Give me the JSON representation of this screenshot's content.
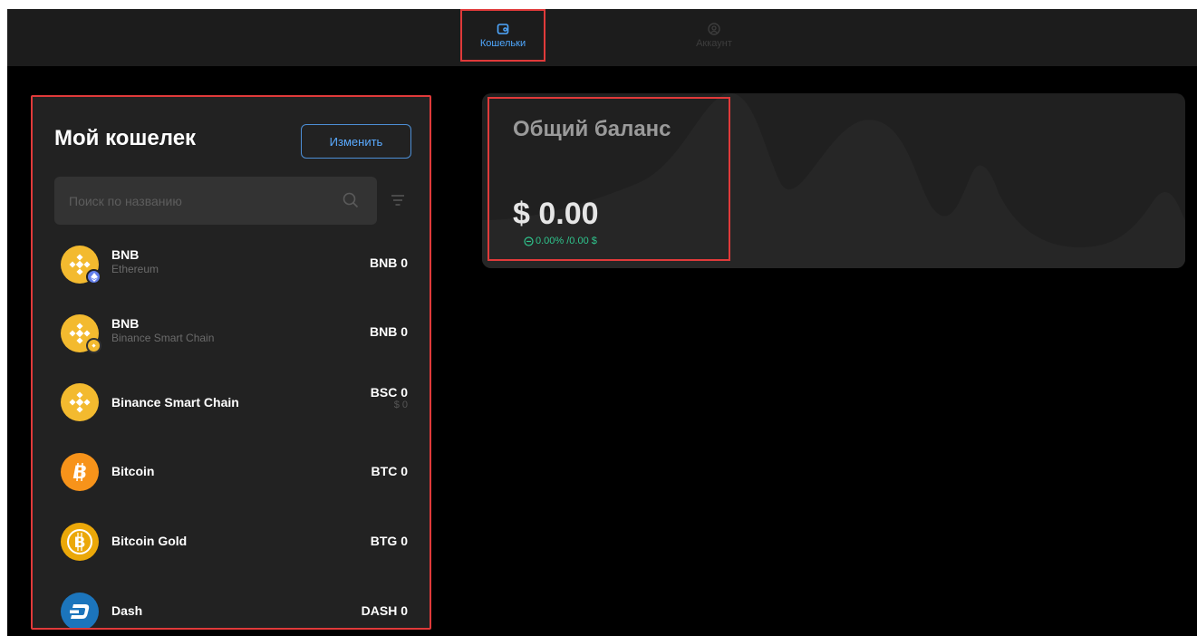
{
  "nav": {
    "wallets_label": "Кошельки",
    "account_label": "Аккаунт",
    "active": "wallets",
    "active_color": "#4fa8ff"
  },
  "wallet": {
    "title": "Мой кошелек",
    "edit_label": "Изменить",
    "search_placeholder": "Поиск по названию",
    "items": [
      {
        "name": "BNB",
        "subtitle": "Ethereum",
        "amount": "BNB 0",
        "fiat": "",
        "icon": "binance-icon",
        "badge": "ethereum-badge-icon"
      },
      {
        "name": "BNB",
        "subtitle": "Binance Smart Chain",
        "amount": "BNB 0",
        "fiat": "",
        "icon": "binance-icon",
        "badge": "bsc-badge-icon"
      },
      {
        "name": "Binance Smart Chain",
        "subtitle": "",
        "amount": "BSC 0",
        "fiat": "$ 0",
        "icon": "binance-icon",
        "badge": ""
      },
      {
        "name": "Bitcoin",
        "subtitle": "",
        "amount": "BTC 0",
        "fiat": "",
        "icon": "bitcoin-icon",
        "badge": ""
      },
      {
        "name": "Bitcoin Gold",
        "subtitle": "",
        "amount": "BTG 0",
        "fiat": "",
        "icon": "bitcoin-gold-icon",
        "badge": ""
      },
      {
        "name": "Dash",
        "subtitle": "",
        "amount": "DASH 0",
        "fiat": "",
        "icon": "dash-icon",
        "badge": ""
      }
    ]
  },
  "balance": {
    "title": "Общий баланс",
    "amount": "$ 0.00",
    "change": "0.00% /0.00 $",
    "change_color": "#2fc58d"
  },
  "colors": {
    "accent": "#4fa8ff",
    "highlight": "#e03a3a",
    "binance": "#f3ba2f",
    "bitcoin": "#f7931a",
    "dash": "#1c75bc"
  }
}
